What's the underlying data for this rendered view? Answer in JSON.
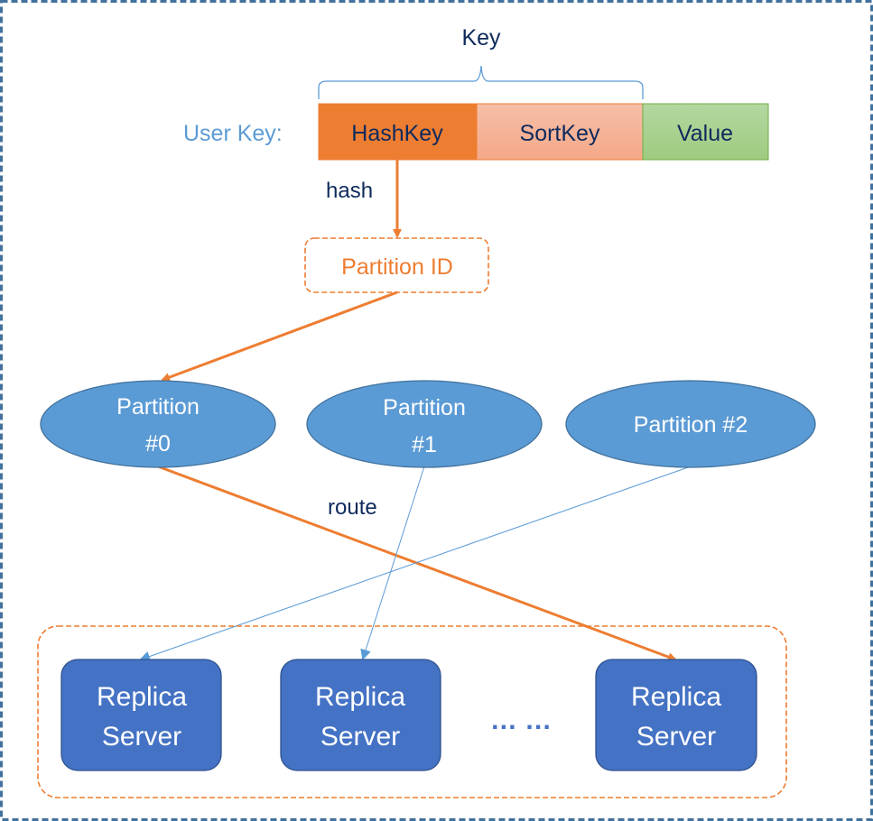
{
  "diagram": {
    "key_label": "Key",
    "user_key_label": "User Key:",
    "segments": [
      {
        "label": "HashKey",
        "fill": "#ED7D31"
      },
      {
        "label": "SortKey",
        "fill": "#F4B29A"
      },
      {
        "label": "Value",
        "fill": "#A9D18E"
      }
    ],
    "hash_label": "hash",
    "partition_id_label": "Partition ID",
    "route_label": "route",
    "partitions": [
      {
        "lines": [
          "Partition",
          "#0"
        ]
      },
      {
        "lines": [
          "Partition",
          "#1"
        ]
      },
      {
        "lines": [
          "Partition #2"
        ]
      }
    ],
    "replica_servers": [
      {
        "lines": [
          "Replica",
          "Server"
        ]
      },
      {
        "lines": [
          "Replica",
          "Server"
        ]
      },
      {
        "lines": [
          "Replica",
          "Server"
        ]
      }
    ],
    "ellipsis": "… …",
    "colors": {
      "orange": "#ED7D31",
      "light_blue": "#5B9BD5",
      "dark_blue": "#4472C4",
      "navy_text": "#0E2A5C",
      "user_key_text": "#5B9BD5",
      "frame": "#41719C"
    }
  }
}
